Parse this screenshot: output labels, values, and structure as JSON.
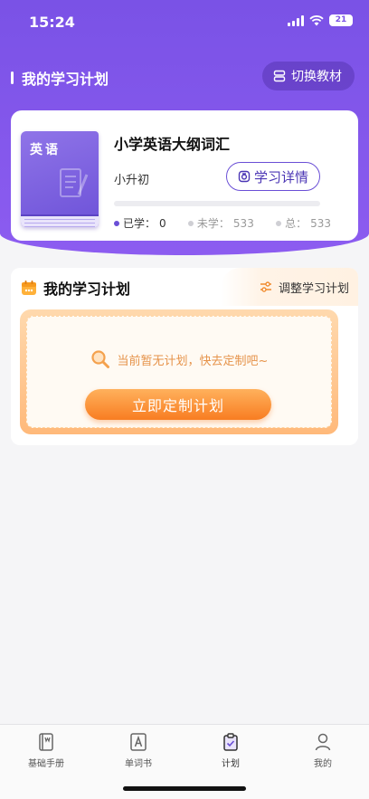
{
  "status_bar": {
    "time": "15:24",
    "battery": "21"
  },
  "header": {
    "title": "我的学习计划",
    "switch_button": "切换教材"
  },
  "book": {
    "cover_label": "英语",
    "title": "小学英语大纲词汇",
    "grade": "小升初",
    "detail_button": "学习详情",
    "progress_fraction": 0,
    "stats": {
      "learned_label": "已学：",
      "learned_value": "0",
      "unlearned_label": "未学：",
      "unlearned_value": "533",
      "total_label": "总：",
      "total_value": "533"
    }
  },
  "plan": {
    "title": "我的学习计划",
    "adjust_button": "调整学习计划",
    "empty_text": "当前暂无计划，快去定制吧~",
    "create_button": "立即定制计划"
  },
  "tabs": [
    {
      "label": "基础手册",
      "icon": "book-icon"
    },
    {
      "label": "单词书",
      "icon": "letter-a-icon"
    },
    {
      "label": "计划",
      "icon": "clipboard-check-icon"
    },
    {
      "label": "我的",
      "icon": "user-icon"
    }
  ],
  "colors": {
    "brand": "#7a52e6",
    "accent_orange": "#f87d22"
  }
}
